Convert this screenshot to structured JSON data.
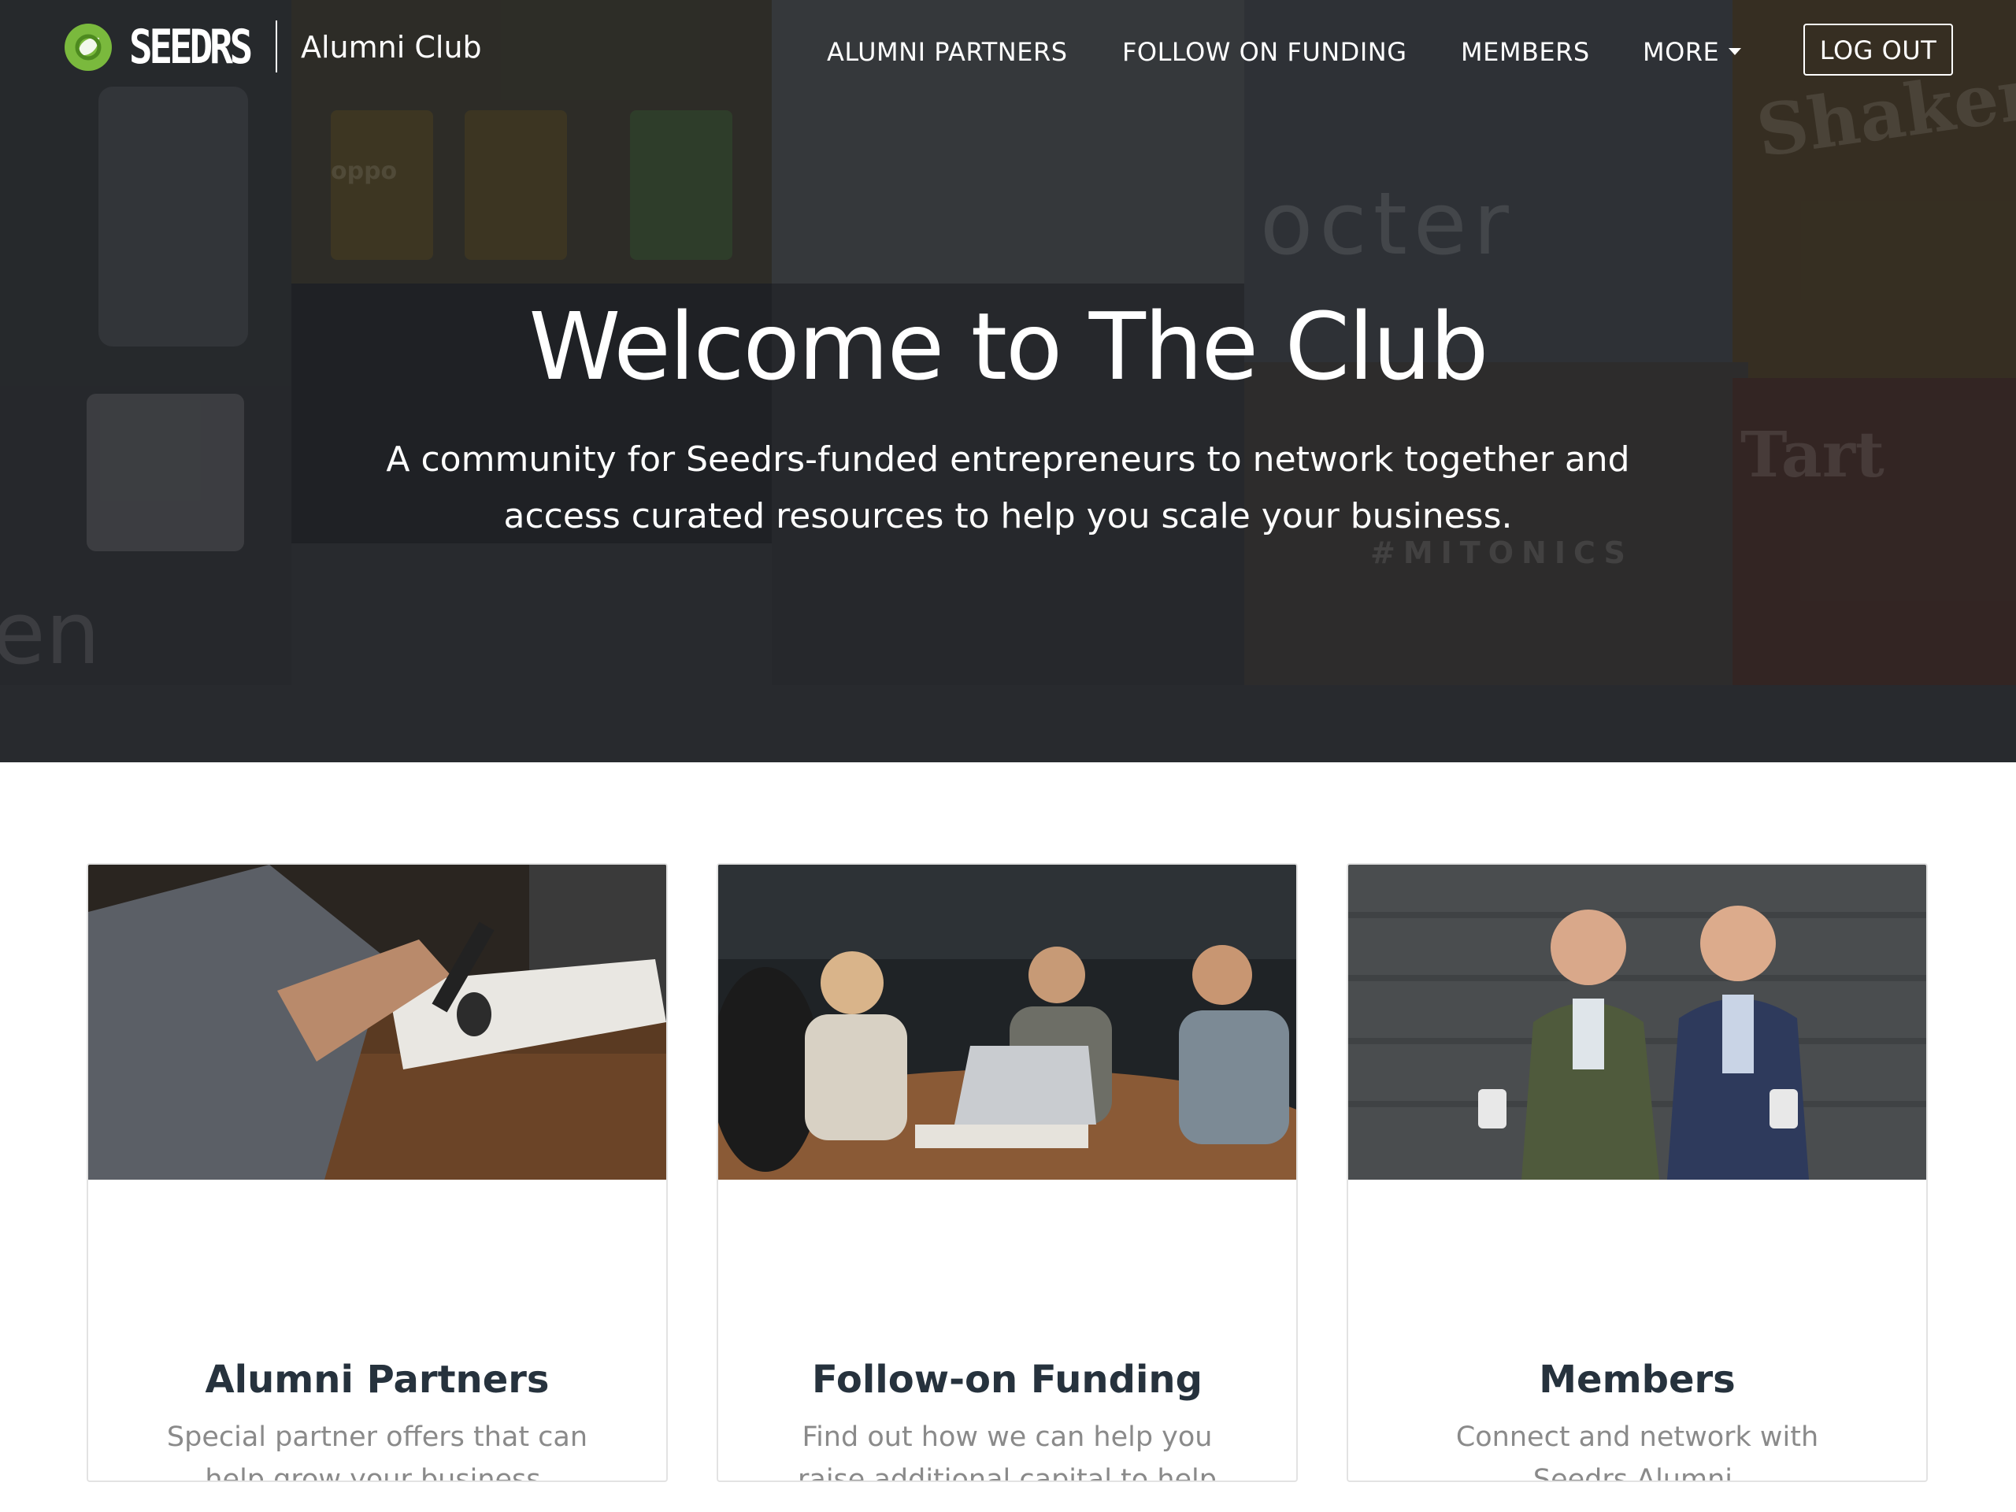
{
  "brand": {
    "logo_text": "SEEDRS",
    "sub_brand": "Alumni Club",
    "accent_color": "#7ab93d"
  },
  "nav": {
    "items": [
      {
        "label": "ALUMNI PARTNERS"
      },
      {
        "label": "FOLLOW ON FUNDING"
      },
      {
        "label": "MEMBERS"
      },
      {
        "label": "MORE"
      }
    ],
    "logout_label": "LOG OUT"
  },
  "hero": {
    "title": "Welcome to The Club",
    "subtitle": "A community for Seedrs-funded entrepreneurs to network together and access curated resources to help you scale your business.",
    "background_words": [
      "octer",
      "Tart",
      "#MITONICS",
      "Shaker",
      "oppo",
      "en"
    ]
  },
  "cards": [
    {
      "title": "Alumni Partners",
      "description": "Special partner offers that can help grow your business.",
      "image": "person-signing-document"
    },
    {
      "title": "Follow-on Funding",
      "description": "Find out how we can help you raise additional capital to help you grow",
      "image": "team-meeting-around-laptop"
    },
    {
      "title": "Members",
      "description": "Connect and network with Seedrs Alumni.",
      "image": "two-men-in-suits-smiling"
    }
  ]
}
